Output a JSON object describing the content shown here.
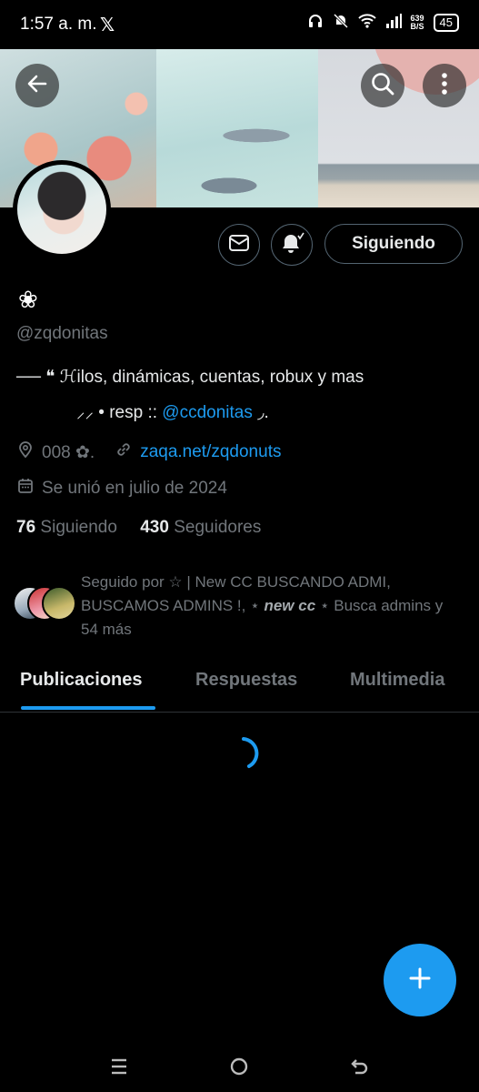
{
  "status_bar": {
    "time": "1:57 a. m.",
    "app_icon": "x-logo",
    "net_speed_value": "639",
    "net_speed_unit": "B/S",
    "battery": "45"
  },
  "profile": {
    "display_name": "❀",
    "handle": "@zqdonitas",
    "bio_line1": "── ❝ ℋilos, dinámicas, cuentas, robux y mas",
    "bio_line2_prefix": "⸝⸝   •  resp :: ",
    "bio_mention": "@ccdonitas",
    "bio_line2_suffix": " ◞.",
    "location": "008 ✿.",
    "website": "zaqa.net/zqdonuts",
    "joined": "Se unió en julio de 2024",
    "following_count": "76",
    "following_label": "Siguiendo",
    "followers_count": "430",
    "followers_label": "Seguidores",
    "followed_by_prefix": "Seguido por ☆ | New CC BUSCANDO ADMI, BUSCAMOS ADMINS !, ⋆ ",
    "followed_by_bold": "new cc",
    "followed_by_suffix": " ⋆ Busca admins y 54 más"
  },
  "buttons": {
    "follow_label": "Siguiendo"
  },
  "tabs": [
    {
      "label": "Publicaciones",
      "active": true
    },
    {
      "label": "Respuestas",
      "active": false
    },
    {
      "label": "Multimedia",
      "active": false
    }
  ],
  "colors": {
    "accent": "#1d9bf0",
    "background": "#000000",
    "muted_text": "#71767b"
  },
  "icons": [
    "back-arrow-icon",
    "search-icon",
    "more-vertical-icon",
    "mail-icon",
    "notification-bell-icon",
    "location-icon",
    "link-icon",
    "calendar-icon",
    "plus-icon",
    "loading-spinner-icon"
  ]
}
